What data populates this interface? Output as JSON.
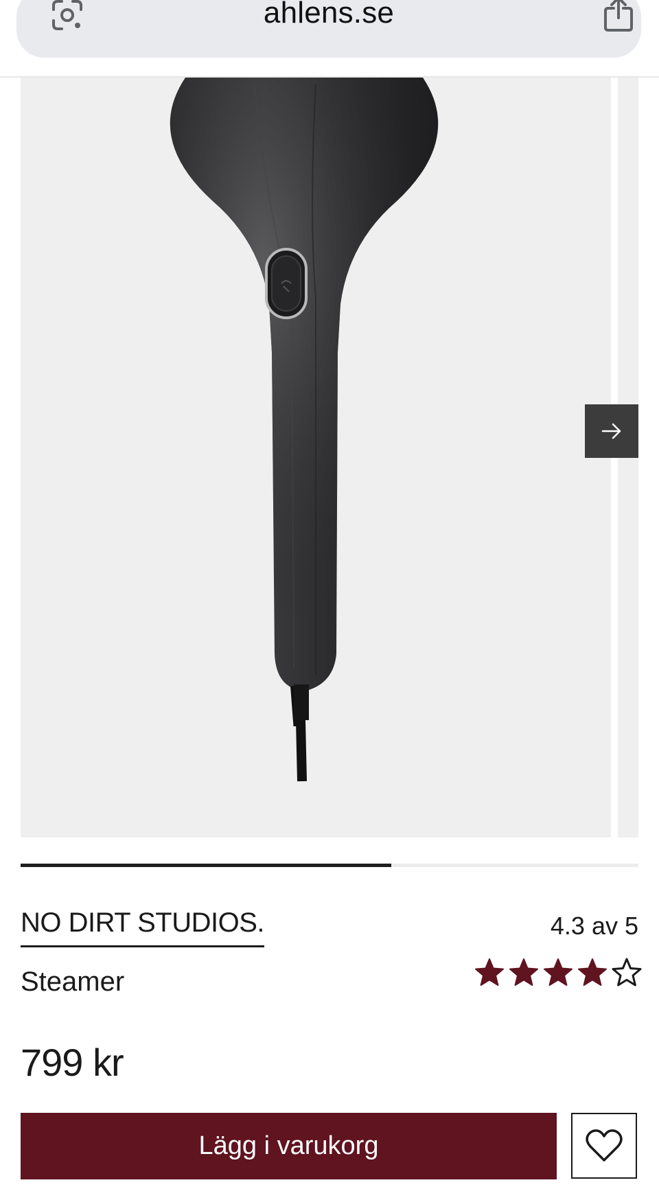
{
  "browser": {
    "url": "ahlens.se",
    "lens_icon": "camera-search-icon",
    "share_icon": "share-icon"
  },
  "gallery": {
    "next_icon": "arrow-right-icon",
    "progress_fraction": 0.6
  },
  "product": {
    "brand": "NO DIRT STUDIOS.",
    "name": "Steamer",
    "rating_text": "4.3 av 5",
    "rating_value": 4.3,
    "rating_max": 5,
    "price": "799 kr",
    "add_to_cart_label": "Lägg i varukorg",
    "wishlist_icon": "heart-icon"
  },
  "colors": {
    "accent": "#5f1420",
    "star_fill": "#5f1420",
    "image_background": "#efefef"
  }
}
